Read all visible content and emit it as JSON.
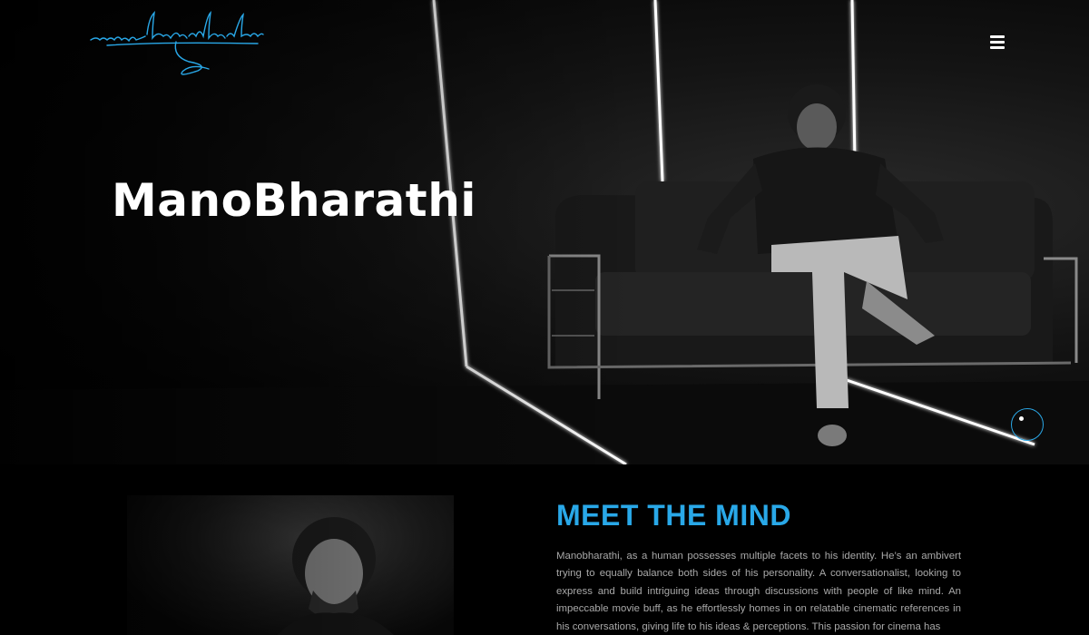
{
  "header": {
    "logo_text": "manobharathi",
    "logo_icon": "signature-logo",
    "menu_icon": "hamburger-menu-icon"
  },
  "hero": {
    "title": "ManoBharathi",
    "scroll_icon": "scroll-indicator-icon"
  },
  "about": {
    "heading": "MEET THE MIND",
    "paragraph": "Manobharathi, as a human possesses multiple facets to his identity. He’s an ambivert trying to equally balance both sides of his personality. A conversationalist, looking to express and build intriguing ideas through discussions with people of like mind. An impeccable movie buff, as he effortlessly homes in on relatable cinematic references in his conversations, giving life to his ideas & perceptions. This passion for cinema has"
  },
  "colors": {
    "accent": "#29a8e8",
    "background": "#000000",
    "body_text": "#a9a9a9"
  }
}
